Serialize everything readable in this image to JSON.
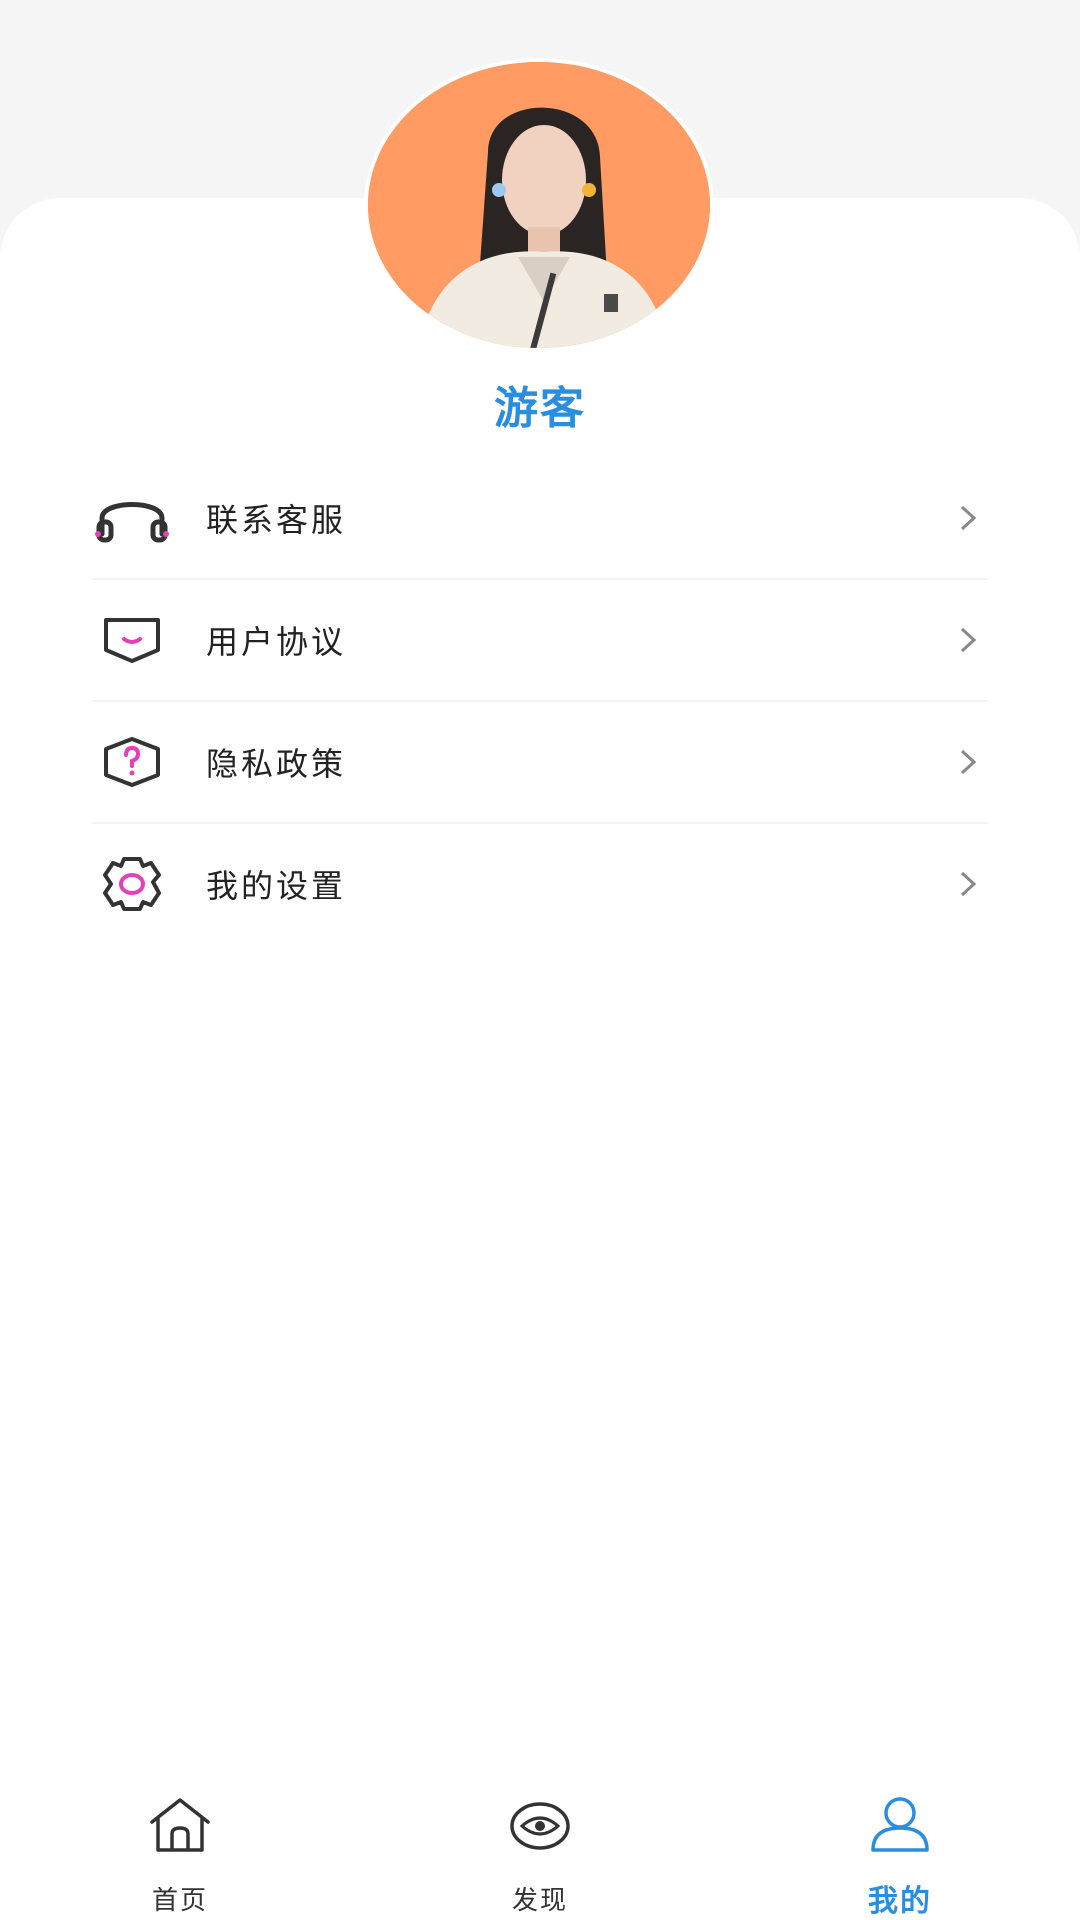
{
  "profile": {
    "username": "游客"
  },
  "menu": {
    "items": [
      {
        "label": "联系客服",
        "icon": "headset-icon"
      },
      {
        "label": "用户协议",
        "icon": "agreement-icon"
      },
      {
        "label": "隐私政策",
        "icon": "privacy-question-icon"
      },
      {
        "label": "我的设置",
        "icon": "gear-icon"
      }
    ]
  },
  "tabbar": {
    "items": [
      {
        "label": "首页",
        "icon": "home-icon",
        "active": false
      },
      {
        "label": "发现",
        "icon": "eye-icon",
        "active": false
      },
      {
        "label": "我的",
        "icon": "user-icon",
        "active": true
      }
    ]
  },
  "colors": {
    "accent": "#2a8ee0",
    "icon_accent": "#e83fb8",
    "avatar_bg": "#ff9b63"
  }
}
